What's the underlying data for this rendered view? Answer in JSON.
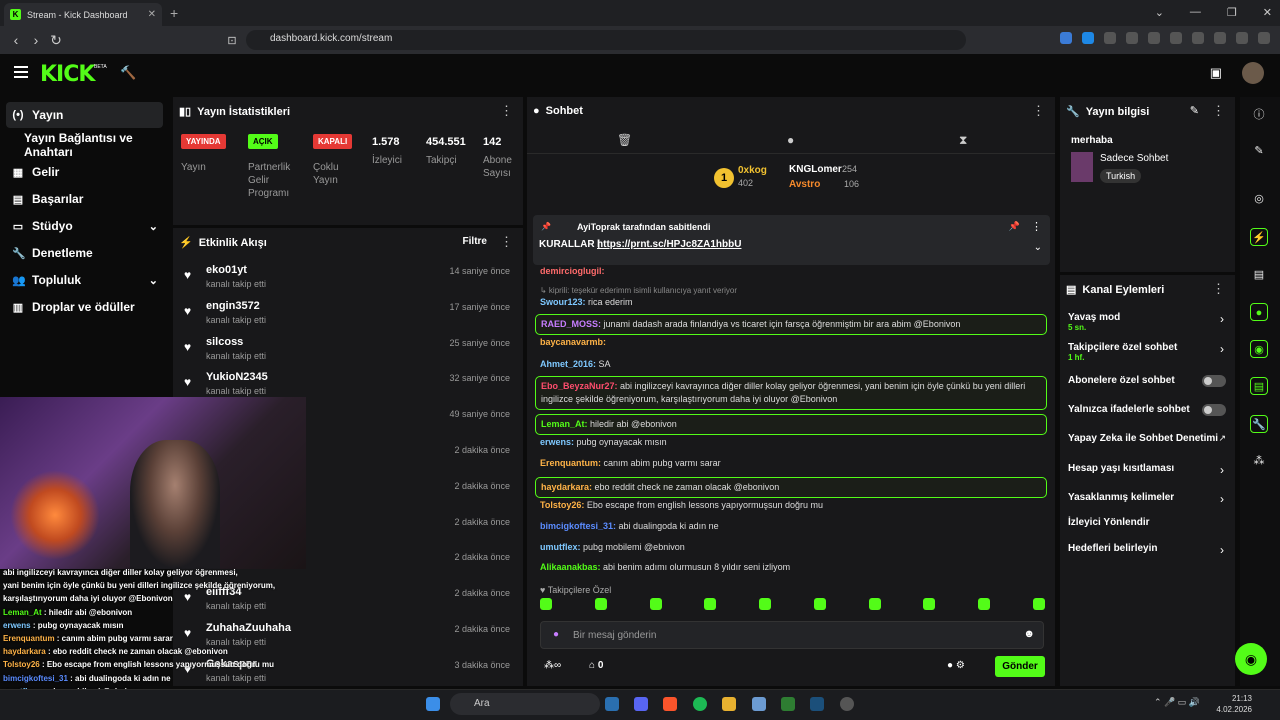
{
  "browser": {
    "tab_title": "Stream - Kick Dashboard",
    "url": "dashboard.kick.com/stream"
  },
  "app": {
    "logo": "KICK",
    "beta": "BETA"
  },
  "sidebar": {
    "items": [
      {
        "label": "Yayın",
        "icon": "broadcast-icon"
      },
      {
        "label": "Yayın Bağlantısı ve Anahtarı",
        "icon": ""
      },
      {
        "label": "Gelir",
        "icon": "revenue-icon"
      },
      {
        "label": "Başarılar",
        "icon": "achievements-icon"
      },
      {
        "label": "Stüdyo",
        "icon": "studio-icon"
      },
      {
        "label": "Denetleme",
        "icon": "wrench-icon"
      },
      {
        "label": "Topluluk",
        "icon": "community-icon"
      },
      {
        "label": "Droplar ve ödüller",
        "icon": "gift-icon"
      }
    ]
  },
  "stats": {
    "title": "Yayın İstatistikleri",
    "items": [
      {
        "badge": "YAYINDA",
        "label": "Yayın"
      },
      {
        "badge": "AÇIK",
        "label": "Partnerlik Gelir Programı"
      },
      {
        "badge": "KAPALI",
        "label": "Çoklu Yayın"
      },
      {
        "value": "1.578",
        "label": "İzleyici"
      },
      {
        "value": "454.551",
        "label": "Takipçi"
      },
      {
        "value": "142",
        "label": "Abone Sayısı"
      }
    ]
  },
  "feed": {
    "title": "Etkinlik Akışı",
    "filter": "Filtre",
    "rows": [
      {
        "name": "eko01yt",
        "action": "kanalı takip etti",
        "time": "14 saniye önce"
      },
      {
        "name": "engin3572",
        "action": "kanalı takip etti",
        "time": "17 saniye önce"
      },
      {
        "name": "silcoss",
        "action": "kanalı takip etti",
        "time": "25 saniye önce"
      },
      {
        "name": "YukioN2345",
        "action": "kanalı takip etti",
        "time": "32 saniye önce"
      },
      {
        "name": "",
        "action": "",
        "time": "49 saniye önce"
      },
      {
        "name": "",
        "action": "",
        "time": "2 dakika önce"
      },
      {
        "name": "",
        "action": "",
        "time": "2 dakika önce"
      },
      {
        "name": "",
        "action": "",
        "time": "2 dakika önce"
      },
      {
        "name": "",
        "action": "",
        "time": "2 dakika önce"
      },
      {
        "name": "eiifff34",
        "action": "kanalı takip etti",
        "time": "2 dakika önce"
      },
      {
        "name": "ZuhahaZuuhaha",
        "action": "kanalı takip etti",
        "time": "2 dakika önce"
      },
      {
        "name": "Gekaspnr",
        "action": "kanalı takip etti",
        "time": "3 dakika önce"
      }
    ]
  },
  "chat": {
    "title": "Sohbet",
    "leaderboard": [
      {
        "name": "0xkog",
        "value": "402"
      },
      {
        "name": "KNGLomer",
        "value": "254"
      },
      {
        "name": "Avstro",
        "value": "106"
      }
    ],
    "pinned": {
      "by": "AyiToprak tarafından sabitlendi",
      "text_prefix": "KURALLAR |",
      "link": "https://prnt.sc/HPJc8ZA1hbbU"
    },
    "messages": [
      {
        "user": "demircioglugil:",
        "text": "",
        "color": "#ff6b6b",
        "hl": false
      },
      {
        "user": "",
        "text": "↳ kiprili: teşekür ederimm isimli kullanıcıya yanıt veriyor",
        "color": "#888",
        "hl": false
      },
      {
        "user": "Swour123:",
        "text": "rica ederim",
        "color": "#7ec8ff",
        "hl": false
      },
      {
        "user": "RAED_MOSS:",
        "text": "junami dadash arada finlandiya vs ticaret için farsça öğrenmiştim bir ara abim @Ebonivon",
        "color": "#c77dff",
        "hl": true
      },
      {
        "user": "baycanavarmb:",
        "text": "",
        "color": "#ffb347",
        "hl": false
      },
      {
        "user": "Ahmet_2016:",
        "text": "SA",
        "color": "#7ec8ff",
        "hl": false
      },
      {
        "user": "Ebo_BeyzaNur27:",
        "text": "abi ingilizceyi kavrayınca diğer diller kolay geliyor öğrenmesi, yani benim için öyle çünkü bu yeni dilleri ingilizce şekilde öğreniyorum, karşılaştırıyorum daha iyi oluyor @Ebonivon",
        "color": "#ff4d6d",
        "hl": true
      },
      {
        "user": "Leman_At:",
        "text": "hiledir abi @ebonivon",
        "color": "#53fc18",
        "hl": true
      },
      {
        "user": "erwens:",
        "text": "pubg oynayacak mısın",
        "color": "#7ec8ff",
        "hl": false
      },
      {
        "user": "Erenquantum:",
        "text": "canım abim pubg varmı sarar",
        "color": "#ffb347",
        "hl": false
      },
      {
        "user": "haydarkara:",
        "text": "ebo reddit check ne zaman olacak @ebonivon",
        "color": "#ffb347",
        "hl": true
      },
      {
        "user": "Tolstoy26:",
        "text": "Ebo escape from english lessons yapıyormuşsun doğru mu",
        "color": "#ffb347",
        "hl": false
      },
      {
        "user": "bimcigkoftesi_31:",
        "text": "abi dualingoda ki adın ne",
        "color": "#5b8cff",
        "hl": false
      },
      {
        "user": "umutflex:",
        "text": "pubg mobilemi @ebnivon",
        "color": "#7ec8ff",
        "hl": false
      },
      {
        "user": "Alikaanakbas:",
        "text": "abi benim adımı olurmusun 8 yıldır seni izliyom",
        "color": "#53fc18",
        "hl": false
      }
    ],
    "followers_only": "Takipçilere Özel",
    "input_placeholder": "Bir mesaj gönderin",
    "points": "0",
    "send": "Gönder"
  },
  "info": {
    "title": "Yayın bilgisi",
    "stream_title": "merhaba",
    "category": "Sadece Sohbet",
    "tag": "Turkish"
  },
  "actions": {
    "title": "Kanal Eylemleri",
    "rows": [
      {
        "label": "Yavaş mod",
        "sub": "5 sn.",
        "kind": "chevron"
      },
      {
        "label": "Takipçilere özel sohbet",
        "sub": "1 hf.",
        "kind": "chevron"
      },
      {
        "label": "Abonelere özel sohbet",
        "sub": "",
        "kind": "toggle"
      },
      {
        "label": "Yalnızca ifadelerle sohbet",
        "sub": "",
        "kind": "toggle"
      },
      {
        "label": "Yapay Zeka ile Sohbet Denetimi",
        "sub": "",
        "kind": "external"
      },
      {
        "label": "Hesap yaşı kısıtlaması",
        "sub": "",
        "kind": "chevron"
      },
      {
        "label": "Yasaklanmış kelimeler",
        "sub": "",
        "kind": "chevron"
      },
      {
        "label": "İzleyici Yönlendir",
        "sub": "",
        "kind": "none"
      },
      {
        "label": "Hedefleri belirleyin",
        "sub": "",
        "kind": "chevron"
      }
    ]
  },
  "overlay_chat": [
    {
      "user": "",
      "text": "abi ingilizceyi kavrayınca diğer diller kolay geliyor öğrenmesi,",
      "color": "#ff4d6d"
    },
    {
      "user": "",
      "text": "yani benim için öyle çünkü bu yeni dilleri ingilizce şekilde öğreniyorum,",
      "color": "#fff"
    },
    {
      "user": "",
      "text": "karşılaştırıyorum daha iyi oluyor @Ebonivon",
      "color": "#fff"
    },
    {
      "user": "Leman_At",
      "text": ": hiledir abi @ebonivon",
      "color": "#53fc18"
    },
    {
      "user": "erwens",
      "text": ": pubg oynayacak mısın",
      "color": "#7ec8ff"
    },
    {
      "user": "Erenquantum",
      "text": ": canım abim pubg varmı sarar",
      "color": "#ffb347"
    },
    {
      "user": "haydarkara",
      "text": ": ebo reddit check ne zaman olacak @ebonivon",
      "color": "#ffb347"
    },
    {
      "user": "Tolstoy26",
      "text": ": Ebo escape from english lessons yapıyormuşsun doğru mu",
      "color": "#ffb347"
    },
    {
      "user": "bimcigkoftesi_31",
      "text": ": abi dualingoda ki adın ne",
      "color": "#5b8cff"
    },
    {
      "user": "umutflex",
      "text": ": pubg mobilemi @ebnivon",
      "color": "#7ec8ff"
    },
    {
      "user": "Alikaanakbas",
      "text": ": abi benim adımı olurmusun 8 yıldır seni izliyom",
      "color": "#53fc18"
    }
  ],
  "taskbar": {
    "search": "Ara",
    "time": "21:13",
    "date": "4.02.2026"
  }
}
